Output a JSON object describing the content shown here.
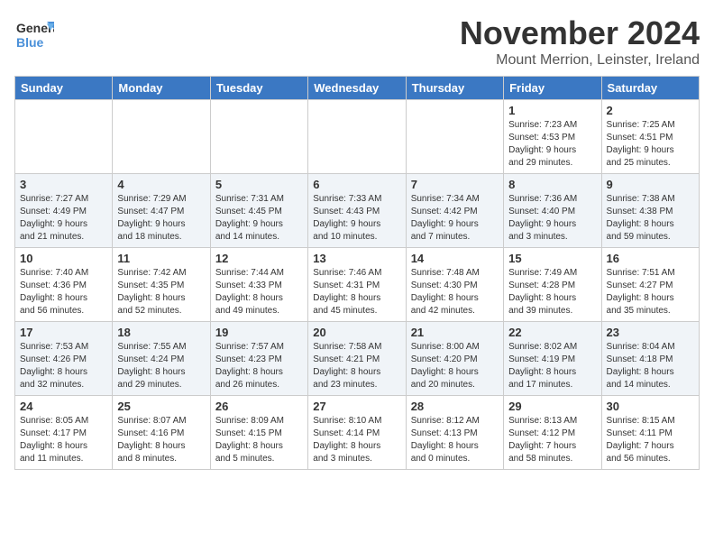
{
  "header": {
    "logo_line1": "General",
    "logo_line2": "Blue",
    "month": "November 2024",
    "location": "Mount Merrion, Leinster, Ireland"
  },
  "weekdays": [
    "Sunday",
    "Monday",
    "Tuesday",
    "Wednesday",
    "Thursday",
    "Friday",
    "Saturday"
  ],
  "weeks": [
    [
      {
        "day": "",
        "info": ""
      },
      {
        "day": "",
        "info": ""
      },
      {
        "day": "",
        "info": ""
      },
      {
        "day": "",
        "info": ""
      },
      {
        "day": "",
        "info": ""
      },
      {
        "day": "1",
        "info": "Sunrise: 7:23 AM\nSunset: 4:53 PM\nDaylight: 9 hours\nand 29 minutes."
      },
      {
        "day": "2",
        "info": "Sunrise: 7:25 AM\nSunset: 4:51 PM\nDaylight: 9 hours\nand 25 minutes."
      }
    ],
    [
      {
        "day": "3",
        "info": "Sunrise: 7:27 AM\nSunset: 4:49 PM\nDaylight: 9 hours\nand 21 minutes."
      },
      {
        "day": "4",
        "info": "Sunrise: 7:29 AM\nSunset: 4:47 PM\nDaylight: 9 hours\nand 18 minutes."
      },
      {
        "day": "5",
        "info": "Sunrise: 7:31 AM\nSunset: 4:45 PM\nDaylight: 9 hours\nand 14 minutes."
      },
      {
        "day": "6",
        "info": "Sunrise: 7:33 AM\nSunset: 4:43 PM\nDaylight: 9 hours\nand 10 minutes."
      },
      {
        "day": "7",
        "info": "Sunrise: 7:34 AM\nSunset: 4:42 PM\nDaylight: 9 hours\nand 7 minutes."
      },
      {
        "day": "8",
        "info": "Sunrise: 7:36 AM\nSunset: 4:40 PM\nDaylight: 9 hours\nand 3 minutes."
      },
      {
        "day": "9",
        "info": "Sunrise: 7:38 AM\nSunset: 4:38 PM\nDaylight: 8 hours\nand 59 minutes."
      }
    ],
    [
      {
        "day": "10",
        "info": "Sunrise: 7:40 AM\nSunset: 4:36 PM\nDaylight: 8 hours\nand 56 minutes."
      },
      {
        "day": "11",
        "info": "Sunrise: 7:42 AM\nSunset: 4:35 PM\nDaylight: 8 hours\nand 52 minutes."
      },
      {
        "day": "12",
        "info": "Sunrise: 7:44 AM\nSunset: 4:33 PM\nDaylight: 8 hours\nand 49 minutes."
      },
      {
        "day": "13",
        "info": "Sunrise: 7:46 AM\nSunset: 4:31 PM\nDaylight: 8 hours\nand 45 minutes."
      },
      {
        "day": "14",
        "info": "Sunrise: 7:48 AM\nSunset: 4:30 PM\nDaylight: 8 hours\nand 42 minutes."
      },
      {
        "day": "15",
        "info": "Sunrise: 7:49 AM\nSunset: 4:28 PM\nDaylight: 8 hours\nand 39 minutes."
      },
      {
        "day": "16",
        "info": "Sunrise: 7:51 AM\nSunset: 4:27 PM\nDaylight: 8 hours\nand 35 minutes."
      }
    ],
    [
      {
        "day": "17",
        "info": "Sunrise: 7:53 AM\nSunset: 4:26 PM\nDaylight: 8 hours\nand 32 minutes."
      },
      {
        "day": "18",
        "info": "Sunrise: 7:55 AM\nSunset: 4:24 PM\nDaylight: 8 hours\nand 29 minutes."
      },
      {
        "day": "19",
        "info": "Sunrise: 7:57 AM\nSunset: 4:23 PM\nDaylight: 8 hours\nand 26 minutes."
      },
      {
        "day": "20",
        "info": "Sunrise: 7:58 AM\nSunset: 4:21 PM\nDaylight: 8 hours\nand 23 minutes."
      },
      {
        "day": "21",
        "info": "Sunrise: 8:00 AM\nSunset: 4:20 PM\nDaylight: 8 hours\nand 20 minutes."
      },
      {
        "day": "22",
        "info": "Sunrise: 8:02 AM\nSunset: 4:19 PM\nDaylight: 8 hours\nand 17 minutes."
      },
      {
        "day": "23",
        "info": "Sunrise: 8:04 AM\nSunset: 4:18 PM\nDaylight: 8 hours\nand 14 minutes."
      }
    ],
    [
      {
        "day": "24",
        "info": "Sunrise: 8:05 AM\nSunset: 4:17 PM\nDaylight: 8 hours\nand 11 minutes."
      },
      {
        "day": "25",
        "info": "Sunrise: 8:07 AM\nSunset: 4:16 PM\nDaylight: 8 hours\nand 8 minutes."
      },
      {
        "day": "26",
        "info": "Sunrise: 8:09 AM\nSunset: 4:15 PM\nDaylight: 8 hours\nand 5 minutes."
      },
      {
        "day": "27",
        "info": "Sunrise: 8:10 AM\nSunset: 4:14 PM\nDaylight: 8 hours\nand 3 minutes."
      },
      {
        "day": "28",
        "info": "Sunrise: 8:12 AM\nSunset: 4:13 PM\nDaylight: 8 hours\nand 0 minutes."
      },
      {
        "day": "29",
        "info": "Sunrise: 8:13 AM\nSunset: 4:12 PM\nDaylight: 7 hours\nand 58 minutes."
      },
      {
        "day": "30",
        "info": "Sunrise: 8:15 AM\nSunset: 4:11 PM\nDaylight: 7 hours\nand 56 minutes."
      }
    ]
  ]
}
